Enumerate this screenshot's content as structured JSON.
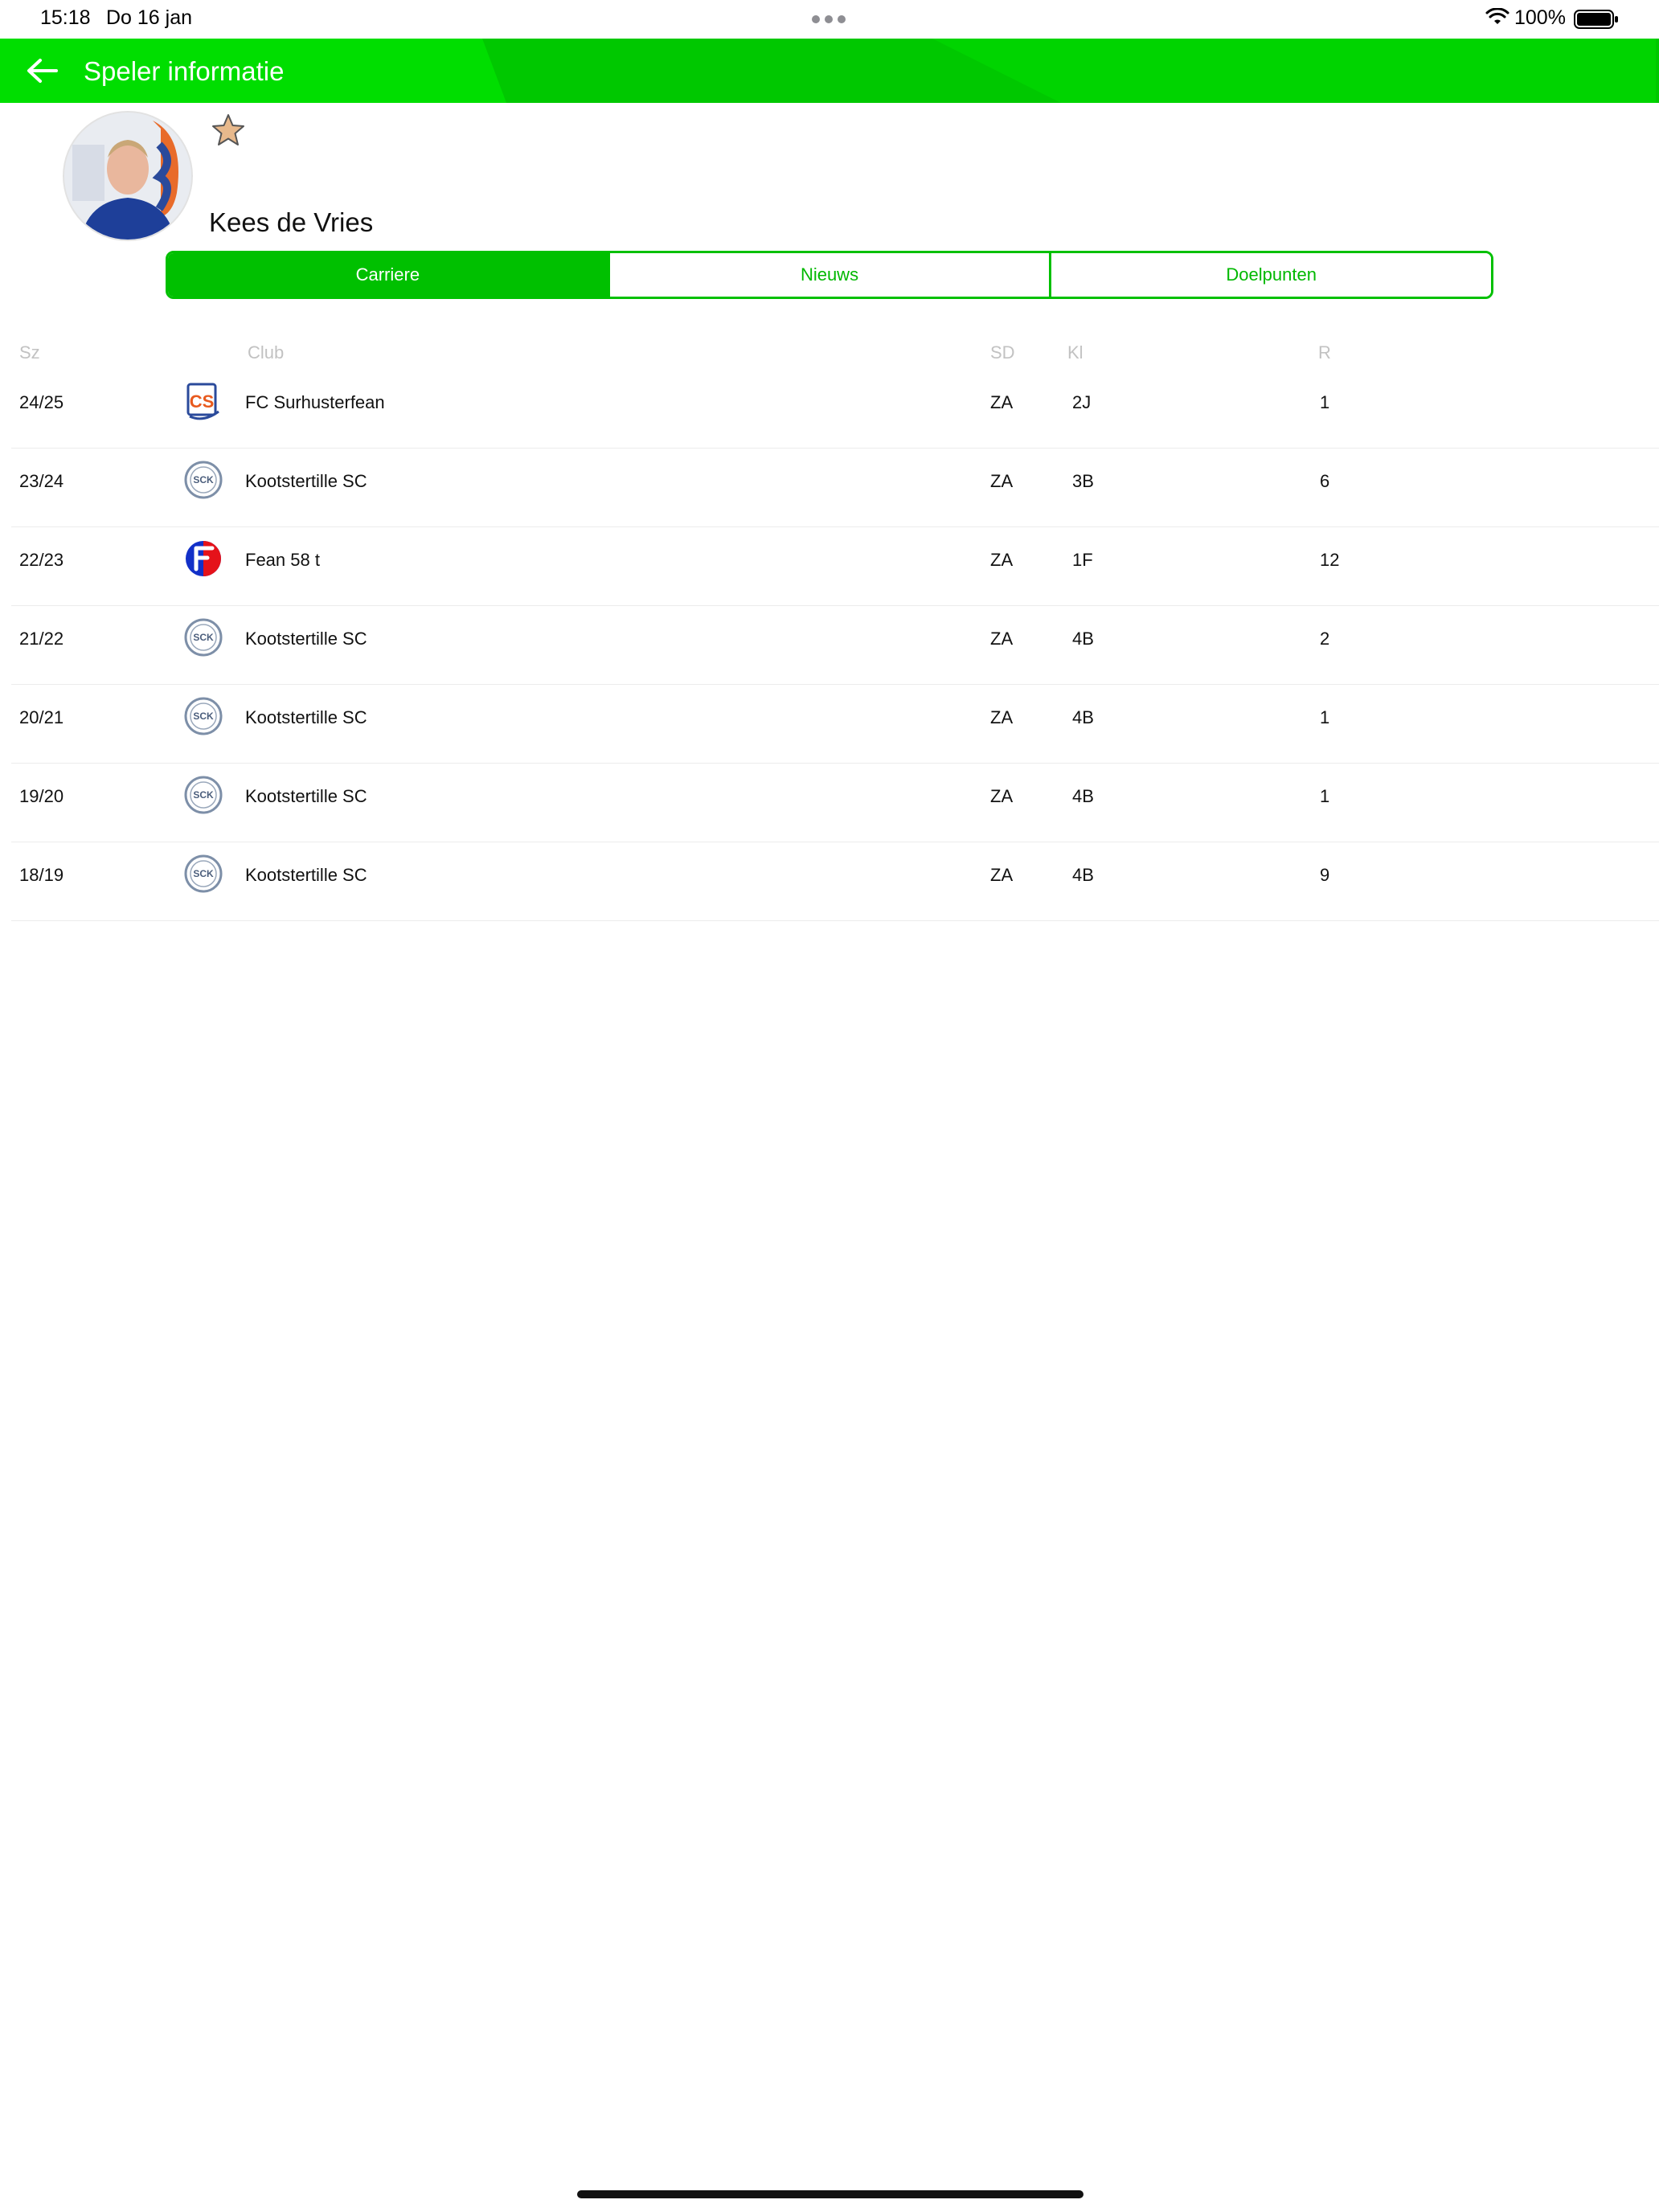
{
  "status_bar": {
    "time": "15:18",
    "date": "Do 16 jan",
    "battery": "100%"
  },
  "header": {
    "title": "Speler informatie",
    "accent": "#00c800"
  },
  "player": {
    "name": "Kees de Vries"
  },
  "tabs": [
    {
      "label": "Carriere",
      "active": true
    },
    {
      "label": "Nieuws",
      "active": false
    },
    {
      "label": "Doelpunten",
      "active": false
    }
  ],
  "columns": {
    "season": "Sz",
    "club": "Club",
    "sd": "SD",
    "kl": "Kl",
    "r": "R"
  },
  "rows": [
    {
      "season": "24/25",
      "club": "FC Surhusterfean",
      "logo": "fcs-logo",
      "sd": "ZA",
      "kl": "2J",
      "r": "1"
    },
    {
      "season": "23/24",
      "club": "Kootstertille SC",
      "logo": "sck-logo",
      "sd": "ZA",
      "kl": "3B",
      "r": "6"
    },
    {
      "season": "22/23",
      "club": "Fean 58 t",
      "logo": "fean-logo",
      "sd": "ZA",
      "kl": "1F",
      "r": "12"
    },
    {
      "season": "21/22",
      "club": "Kootstertille SC",
      "logo": "sck-logo",
      "sd": "ZA",
      "kl": "4B",
      "r": "2"
    },
    {
      "season": "20/21",
      "club": "Kootstertille SC",
      "logo": "sck-logo",
      "sd": "ZA",
      "kl": "4B",
      "r": "1"
    },
    {
      "season": "19/20",
      "club": "Kootstertille SC",
      "logo": "sck-logo",
      "sd": "ZA",
      "kl": "4B",
      "r": "1"
    },
    {
      "season": "18/19",
      "club": "Kootstertille SC",
      "logo": "sck-logo",
      "sd": "ZA",
      "kl": "4B",
      "r": "9"
    }
  ]
}
